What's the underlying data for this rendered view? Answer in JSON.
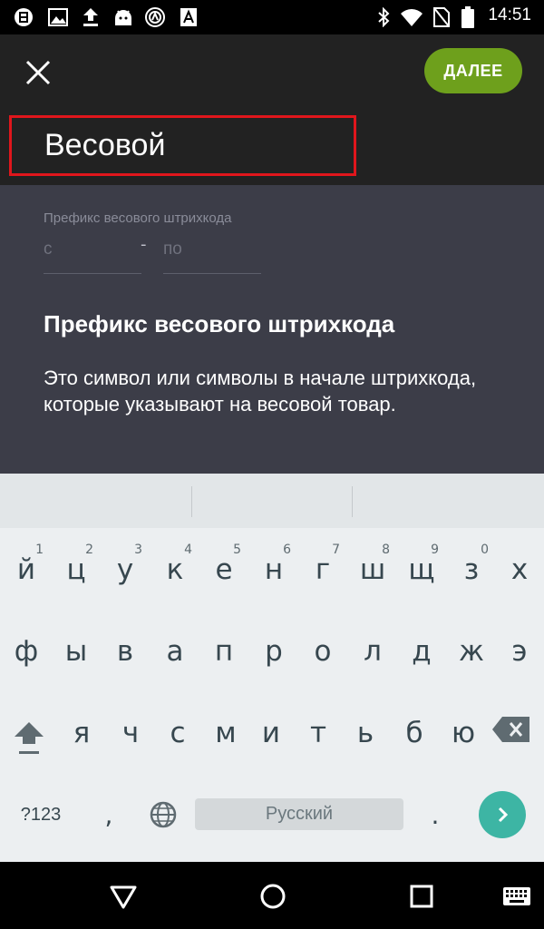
{
  "status_bar": {
    "time": "14:51",
    "left_icons": [
      "app-notification-icon",
      "image-icon",
      "upload-icon",
      "android-icon",
      "vpn-icon",
      "translate-icon"
    ],
    "right_icons": [
      "bluetooth-icon",
      "wifi-icon",
      "no-sim-icon",
      "battery-icon"
    ]
  },
  "app_bar": {
    "next_label": "ДАЛЕЕ",
    "title": "Весовой",
    "highlight_color": "#e0161c",
    "accent_color": "#6ea01c"
  },
  "content": {
    "prefix_label": "Префикс весового штрихкода",
    "from_placeholder": "с",
    "to_placeholder": "по",
    "separator": "-",
    "help_title": "Префикс весового штрихкода",
    "help_text": "Это символ или символы в начале штрихкода, которые указывают на весовой товар."
  },
  "keyboard": {
    "row1": [
      {
        "k": "й",
        "h": "1"
      },
      {
        "k": "ц",
        "h": "2"
      },
      {
        "k": "у",
        "h": "3"
      },
      {
        "k": "к",
        "h": "4"
      },
      {
        "k": "е",
        "h": "5"
      },
      {
        "k": "н",
        "h": "6"
      },
      {
        "k": "г",
        "h": "7"
      },
      {
        "k": "ш",
        "h": "8"
      },
      {
        "k": "щ",
        "h": "9"
      },
      {
        "k": "з",
        "h": "0"
      },
      {
        "k": "х",
        "h": ""
      }
    ],
    "row2": [
      "ф",
      "ы",
      "в",
      "а",
      "п",
      "р",
      "о",
      "л",
      "д",
      "ж",
      "э"
    ],
    "row3": [
      "я",
      "ч",
      "с",
      "м",
      "и",
      "т",
      "ь",
      "б",
      "ю"
    ],
    "symbols_label": "?123",
    "comma": ",",
    "space_label": "Русский",
    "period": "."
  },
  "nav_bar": {
    "icons": [
      "back-icon",
      "home-icon",
      "recents-icon",
      "keyboard-switch-icon"
    ]
  }
}
